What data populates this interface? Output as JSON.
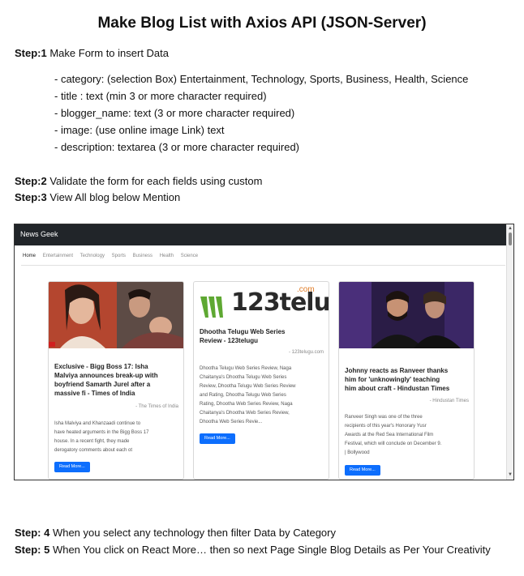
{
  "title": "Make Blog List with Axios API (JSON-Server)",
  "steps": {
    "s1": {
      "label": "Step:1",
      "text": " Make Form to insert Data"
    },
    "s1_items": [
      "- category: (selection Box) Entertainment, Technology, Sports, Business, Health, Science",
      "- title : text (min 3 or more character required)",
      "- blogger_name: text (3 or more character required)",
      "- image: (use online image Link) text",
      "- description: textarea (3 or more character required)"
    ],
    "s2": {
      "label": "Step:2",
      "text": " Validate the form for each fields using custom"
    },
    "s3": {
      "label": "Step:3",
      "text": " View All blog below Mention"
    },
    "s4": {
      "label": "Step: 4",
      "text": " When you select any technology then filter Data by Category"
    },
    "s5": {
      "label": "Step: 5",
      "text": " When You click on React More… then so next Page Single Blog Details as Per Your Creativity"
    }
  },
  "screenshot": {
    "brand": "News Geek",
    "nav": [
      "Home",
      "Entertainment",
      "Technology",
      "Sports",
      "Business",
      "Health",
      "Science"
    ],
    "cards": [
      {
        "title_lines": [
          "Exclusive - Bigg Boss 17: Isha",
          "Malviya announces break-up with",
          "boyfriend Samarth Jurel after a",
          "massive fi - Times of India"
        ],
        "source": "- The Times of India",
        "desc_lines": [
          "Isha Malviya and Khanzaadi continue to",
          "have heated arguments in the Bigg Boss 17",
          "house. In a recent fight, they made",
          "derogatory comments about each ot"
        ],
        "button": "Read More..."
      },
      {
        "logo_text": "123telugu",
        "logo_com": ".com",
        "title_lines": [
          "Dhootha Telugu Web Series",
          "Review - 123telugu"
        ],
        "source": "- 123telugu.com",
        "desc_lines": [
          "Dhootha Telugu Web Series Review, Naga",
          "Chaitanya's Dhootha Telugu Web Series",
          "Review, Dhootha Telugu Web Series Review",
          "and Rating, Dhootha Telugu Web Series",
          "Rating, Dhootha Web Series Review, Naga",
          "Chaitanya's Dhootha Web Series Review,",
          "Dhootha Web Series Revie..."
        ],
        "button": "Read More..."
      },
      {
        "title_lines": [
          "Johnny reacts as Ranveer thanks",
          "him for 'unknowingly' teaching",
          "him about craft - Hindustan Times"
        ],
        "source": "- Hindustan Times",
        "desc_lines": [
          "Ranveer Singh was one of the three",
          "recipients of this year's Honorary Yusr",
          "Awards at the Red Sea International Film",
          "Festival, which will conclude on December 9.",
          "| Bollywood"
        ],
        "button": "Read More..."
      }
    ]
  },
  "colors": {
    "navbar": "#212529",
    "button": "#0d6efd"
  }
}
